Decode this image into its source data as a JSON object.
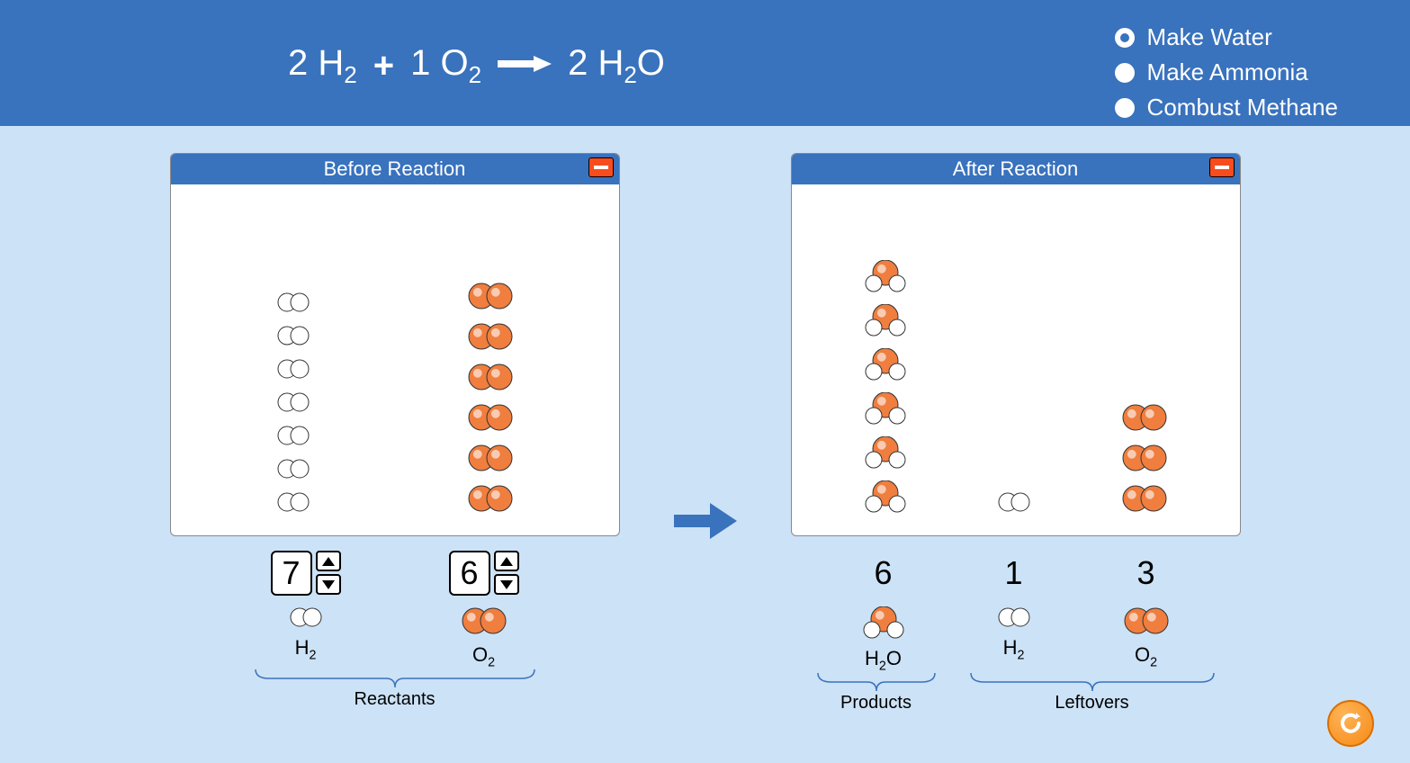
{
  "equation": {
    "coef1": "2",
    "reactant1": "H",
    "reactant1_sub": "2",
    "plus": "+",
    "coef2": "1",
    "reactant2": "O",
    "reactant2_sub": "2",
    "coef3": "2",
    "product": "H",
    "product_sub": "2",
    "product_tail": "O"
  },
  "reactions": {
    "opt1": "Make Water",
    "opt2": "Make Ammonia",
    "opt3": "Combust Methane",
    "selected": "opt1"
  },
  "before": {
    "title": "Before Reaction",
    "h2_count": "7",
    "o2_count": "6",
    "h2_label": "H",
    "h2_sub": "2",
    "o2_label": "O",
    "o2_sub": "2",
    "group_label": "Reactants"
  },
  "after": {
    "title": "After Reaction",
    "h2o_count": "6",
    "h2_left_count": "1",
    "o2_left_count": "3",
    "h2o_label": "H",
    "h2o_sub": "2",
    "h2o_tail": "O",
    "h2_label": "H",
    "h2_sub": "2",
    "o2_label": "O",
    "o2_sub": "2",
    "products_label": "Products",
    "leftovers_label": "Leftovers"
  },
  "chart_data": {
    "type": "table",
    "reaction": "2 H2 + 1 O2 -> 2 H2O",
    "before": {
      "H2": 7,
      "O2": 6
    },
    "after": {
      "H2O": 6,
      "H2_leftover": 1,
      "O2_leftover": 3
    }
  }
}
